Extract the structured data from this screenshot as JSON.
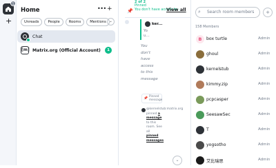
{
  "rail": {
    "badge": "1",
    "add_label": "+"
  },
  "room_list": {
    "title": "Home",
    "more_label": "•••",
    "compose_label": "+",
    "filters": [
      "Unreads",
      "People",
      "Rooms",
      "Mentions"
    ],
    "filter_more": "⌄",
    "rooms": [
      {
        "name": "Chat",
        "active": true,
        "bold": false
      },
      {
        "name": "Matrix.org (Official Account)",
        "active": false,
        "bold": true,
        "unread": "1",
        "avatar_text": "[m]"
      }
    ]
  },
  "timeline": {
    "pinned": {
      "count": "2 of 2",
      "line1": "Pinned",
      "line2": "You don't have access to...",
      "view_all": "View all"
    },
    "sender": "ker...",
    "yo_text": "Yo u...",
    "no_access": "You don't have access to this message",
    "pinned_tag": "Pinned message",
    "system_msg": {
      "prefix": "@kernelstub:matrix.org pinned",
      "link1": "a message",
      "middle": "to this room. See all",
      "link2": "pinned messages",
      "suffix": "."
    },
    "jump_icon": "⌄"
  },
  "members": {
    "search_placeholder": "Search room members",
    "count_label": "158 Members",
    "list": [
      {
        "name": "box turtle",
        "role": "Admin",
        "avatar_text": "B",
        "color": "#e64f7a",
        "avatar_bg": "#fde8ee"
      },
      {
        "name": "ghoul",
        "role": "Admin",
        "avatar_text": "",
        "color": "#8a6d3b",
        "avatar_bg": "#8a6d3b"
      },
      {
        "name": "kernelstub",
        "role": "Admin",
        "avatar_text": "",
        "color": "#2e3238",
        "avatar_bg": "#2e3238"
      },
      {
        "name": "kimmy.zip",
        "role": "Admin",
        "avatar_text": "",
        "color": "#b07a5a",
        "avatar_bg": "#b07a5a"
      },
      {
        "name": "pcpcasper",
        "role": "Admin",
        "avatar_text": "",
        "color": "#6b8e23",
        "avatar_bg": "#7a9a5a"
      },
      {
        "name": "SeesawSec",
        "role": "Admin",
        "avatar_text": "",
        "color": "#3a8a4a",
        "avatar_bg": "#4a9a5a"
      },
      {
        "name": "T",
        "role": "Admin",
        "avatar_text": "",
        "color": "#2e3238",
        "avatar_bg": "#2e3238"
      },
      {
        "name": "yogsotho",
        "role": "Admin",
        "avatar_text": "",
        "color": "#4a4a4a",
        "avatar_bg": "#4a4a4a"
      },
      {
        "name": "艾比瑞思",
        "role": "Admin",
        "avatar_text": "",
        "color": "#1a1a1a",
        "avatar_bg": "#1a1a1a"
      }
    ]
  }
}
